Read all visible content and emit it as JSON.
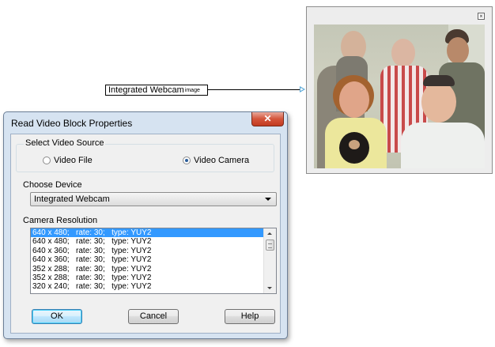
{
  "block": {
    "name": "Integrated Webcam",
    "port": "image"
  },
  "output_window": {
    "close_glyph": "×",
    "image_alt": "webcam frame showing five people"
  },
  "dialog": {
    "title": "Read Video Block Properties",
    "close_glyph": "✕",
    "source_group": {
      "label": "Select Video Source",
      "options": [
        {
          "label": "Video File",
          "selected": false
        },
        {
          "label": "Video Camera",
          "selected": true
        }
      ]
    },
    "device": {
      "label": "Choose Device",
      "value": "Integrated Webcam"
    },
    "resolution": {
      "label": "Camera Resolution",
      "items": [
        "640 x 480;   rate: 30;   type: YUY2",
        "640 x 480;   rate: 30;   type: YUY2",
        "640 x 360;   rate: 30;   type: YUY2",
        "640 x 360;   rate: 30;   type: YUY2",
        "352 x 288;   rate: 30;   type: YUY2",
        "352 x 288;   rate: 30;   type: YUY2",
        "320 x 240;   rate: 30;   type: YUY2"
      ],
      "selected_index": 0
    },
    "buttons": {
      "ok": "OK",
      "cancel": "Cancel",
      "help": "Help"
    }
  },
  "colors": {
    "selection": "#3399ff",
    "port_arrow": "#5aa9d8",
    "close_button": "#c23a20"
  }
}
